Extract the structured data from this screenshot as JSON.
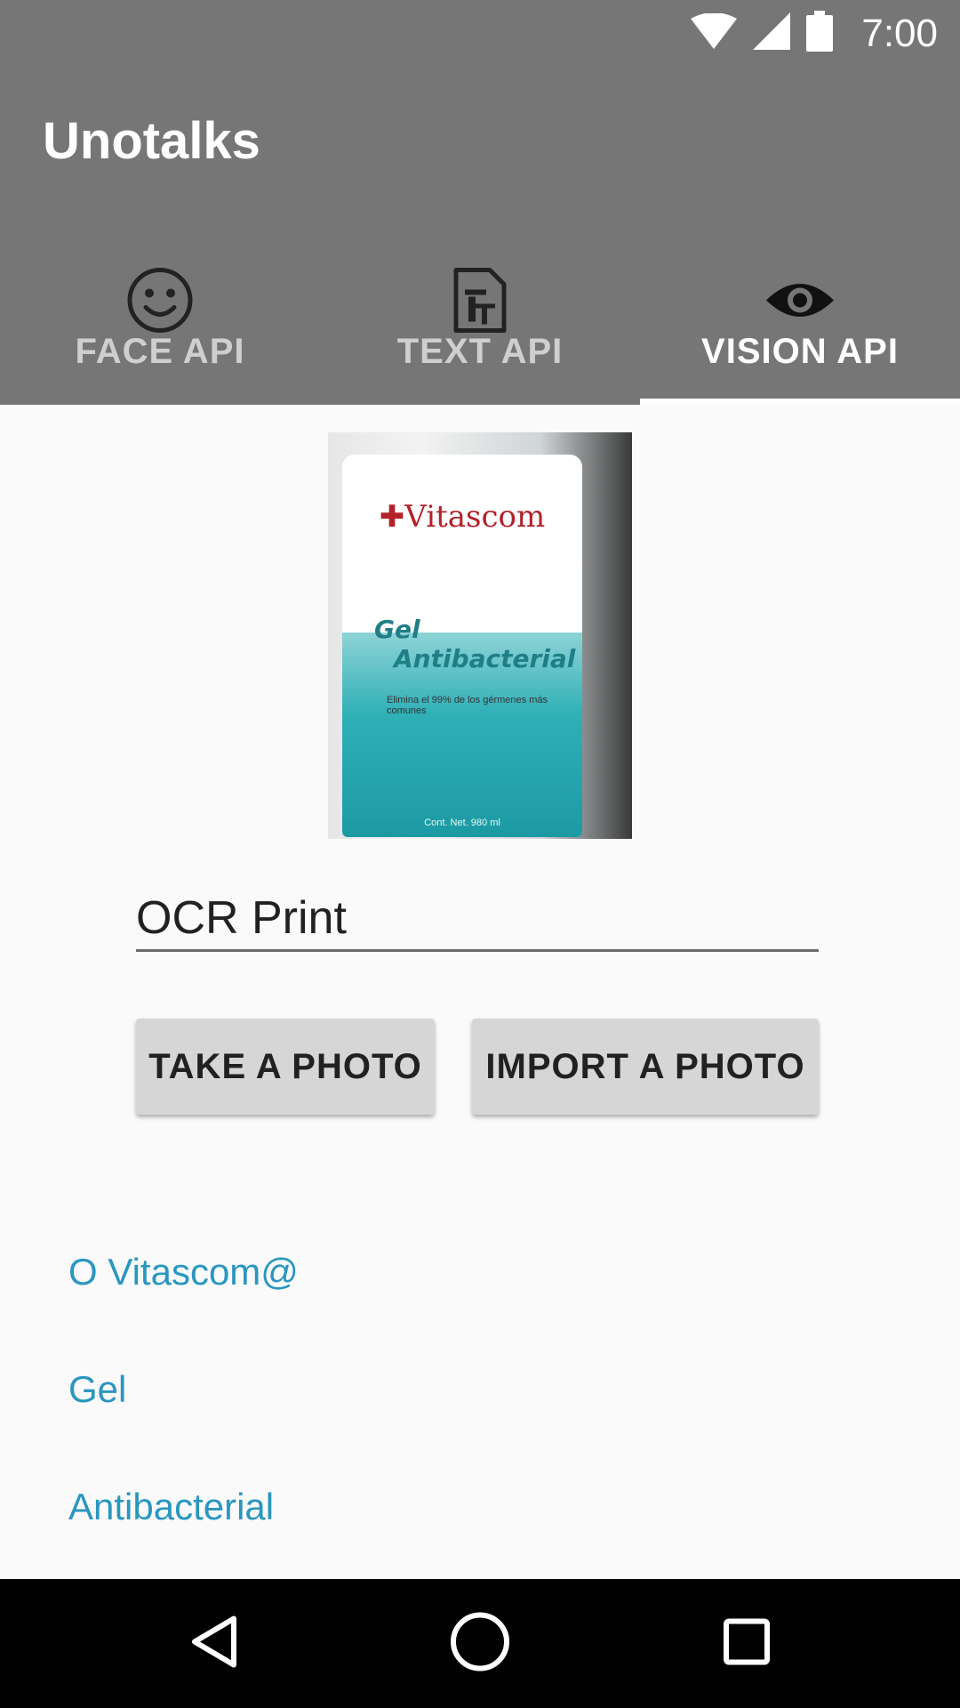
{
  "status_bar": {
    "time": "7:00",
    "icons": [
      "wifi-icon",
      "cell-signal-icon",
      "battery-icon"
    ]
  },
  "app_bar": {
    "title": "Unotalks"
  },
  "tabs": [
    {
      "label": "FACE API",
      "icon": "smiley-face-icon",
      "active": false
    },
    {
      "label": "TEXT API",
      "icon": "text-document-icon",
      "active": false
    },
    {
      "label": "VISION API",
      "icon": "eye-icon",
      "active": true
    }
  ],
  "photo": {
    "brand": "Vitascom",
    "product_line1": "Gel",
    "product_line2": "Antibacterial",
    "fine_print": "Elimina el 99% de los gérmenes más comunes",
    "volume": "Cont. Net. 980 ml"
  },
  "ocr_field": {
    "value": "OCR Print"
  },
  "buttons": {
    "take_photo": "TAKE A PHOTO",
    "import_photo": "IMPORT A PHOTO"
  },
  "results": [
    "O Vitascom@",
    "Gel",
    "Antibacterial"
  ],
  "colors": {
    "app_bar": "#767676",
    "result_text": "#2a96c0",
    "button_bg": "#d6d6d6"
  },
  "nav_bar": {
    "icons": [
      "back-icon",
      "home-icon",
      "recents-icon"
    ]
  }
}
